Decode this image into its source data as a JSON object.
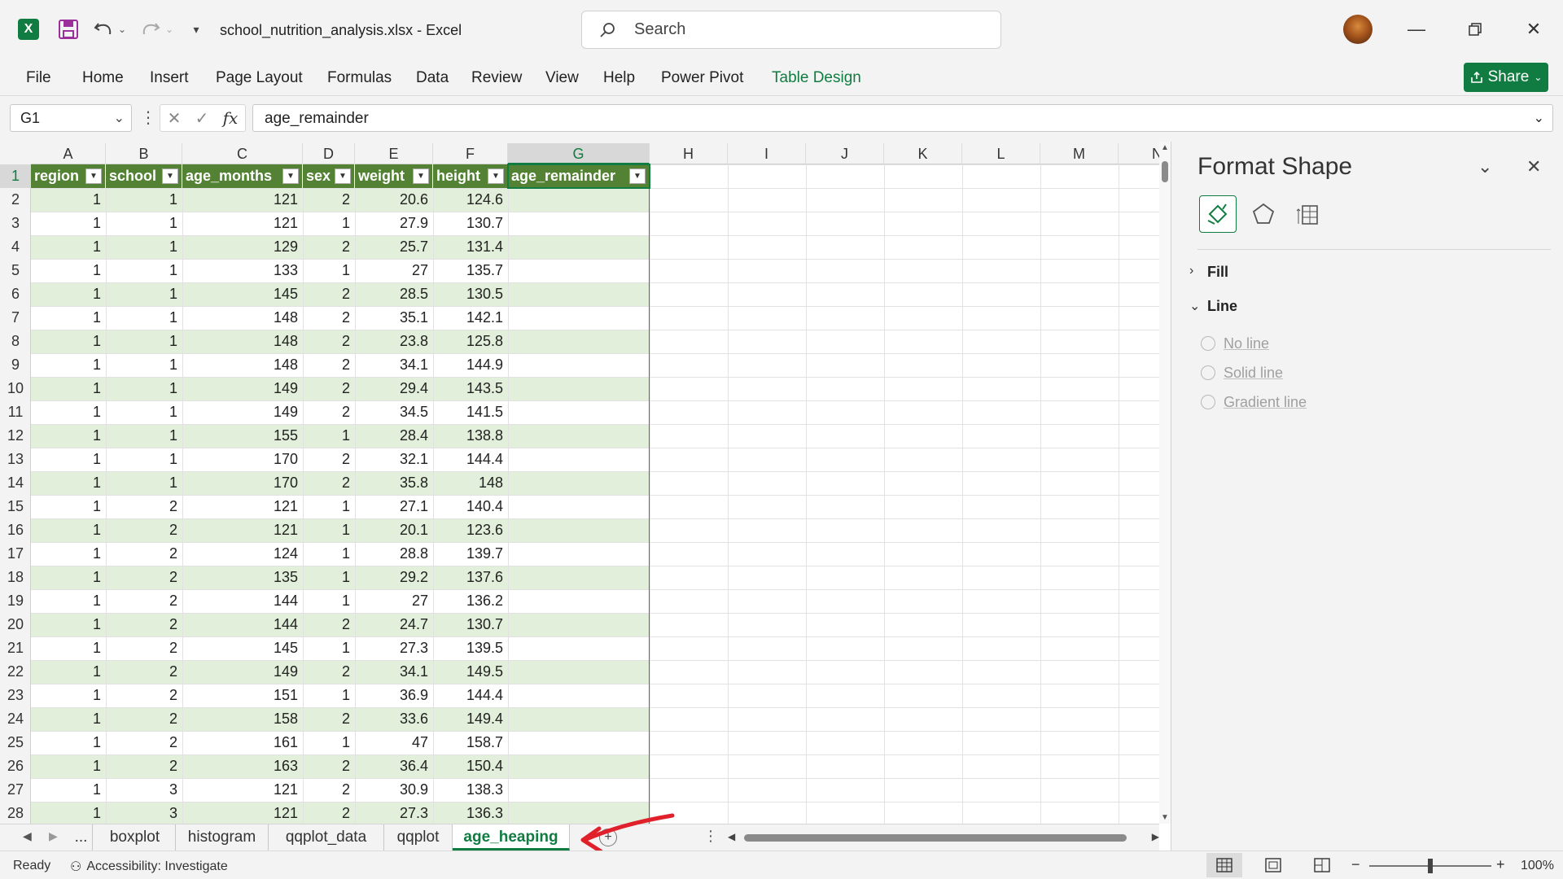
{
  "window": {
    "title": "school_nutrition_analysis.xlsx  -  Excel",
    "search_placeholder": "Search"
  },
  "ribbon": {
    "tabs": [
      "File",
      "Home",
      "Insert",
      "Page Layout",
      "Formulas",
      "Data",
      "Review",
      "View",
      "Help",
      "Power Pivot",
      "Table Design"
    ],
    "share_label": "Share"
  },
  "formula_bar": {
    "name_box": "G1",
    "formula": "age_remainder"
  },
  "sheet": {
    "column_letters": [
      "A",
      "B",
      "C",
      "D",
      "E",
      "F",
      "G",
      "H",
      "I",
      "J",
      "K",
      "L",
      "M",
      "N"
    ],
    "row_numbers": [
      "1",
      "2",
      "3",
      "4",
      "5",
      "6",
      "7",
      "8",
      "9",
      "10",
      "11",
      "12",
      "13",
      "14",
      "15",
      "16",
      "17",
      "18",
      "19",
      "20",
      "21",
      "22",
      "23",
      "24",
      "25",
      "26",
      "27",
      "28"
    ],
    "headers": [
      "region",
      "school",
      "age_months",
      "sex",
      "weight",
      "height",
      "age_remainder"
    ],
    "rows": [
      [
        "1",
        "1",
        "121",
        "2",
        "20.6",
        "124.6"
      ],
      [
        "1",
        "1",
        "121",
        "1",
        "27.9",
        "130.7"
      ],
      [
        "1",
        "1",
        "129",
        "2",
        "25.7",
        "131.4"
      ],
      [
        "1",
        "1",
        "133",
        "1",
        "27",
        "135.7"
      ],
      [
        "1",
        "1",
        "145",
        "2",
        "28.5",
        "130.5"
      ],
      [
        "1",
        "1",
        "148",
        "2",
        "35.1",
        "142.1"
      ],
      [
        "1",
        "1",
        "148",
        "2",
        "23.8",
        "125.8"
      ],
      [
        "1",
        "1",
        "148",
        "2",
        "34.1",
        "144.9"
      ],
      [
        "1",
        "1",
        "149",
        "2",
        "29.4",
        "143.5"
      ],
      [
        "1",
        "1",
        "149",
        "2",
        "34.5",
        "141.5"
      ],
      [
        "1",
        "1",
        "155",
        "1",
        "28.4",
        "138.8"
      ],
      [
        "1",
        "1",
        "170",
        "2",
        "32.1",
        "144.4"
      ],
      [
        "1",
        "1",
        "170",
        "2",
        "35.8",
        "148"
      ],
      [
        "1",
        "2",
        "121",
        "1",
        "27.1",
        "140.4"
      ],
      [
        "1",
        "2",
        "121",
        "1",
        "20.1",
        "123.6"
      ],
      [
        "1",
        "2",
        "124",
        "1",
        "28.8",
        "139.7"
      ],
      [
        "1",
        "2",
        "135",
        "1",
        "29.2",
        "137.6"
      ],
      [
        "1",
        "2",
        "144",
        "1",
        "27",
        "136.2"
      ],
      [
        "1",
        "2",
        "144",
        "2",
        "24.7",
        "130.7"
      ],
      [
        "1",
        "2",
        "145",
        "1",
        "27.3",
        "139.5"
      ],
      [
        "1",
        "2",
        "149",
        "2",
        "34.1",
        "149.5"
      ],
      [
        "1",
        "2",
        "151",
        "1",
        "36.9",
        "144.4"
      ],
      [
        "1",
        "2",
        "158",
        "2",
        "33.6",
        "149.4"
      ],
      [
        "1",
        "2",
        "161",
        "1",
        "47",
        "158.7"
      ],
      [
        "1",
        "2",
        "163",
        "2",
        "36.4",
        "150.4"
      ],
      [
        "1",
        "3",
        "121",
        "2",
        "30.9",
        "138.3"
      ],
      [
        "1",
        "3",
        "121",
        "2",
        "27.3",
        "136.3"
      ]
    ],
    "selected_cell": "G1"
  },
  "sheet_tabs": {
    "ellipsis": "...",
    "tabs": [
      "boxplot",
      "histogram",
      "qqplot_data",
      "qqplot",
      "age_heaping"
    ],
    "active": "age_heaping"
  },
  "status_bar": {
    "ready": "Ready",
    "accessibility": "Accessibility: Investigate",
    "zoom": "100%"
  },
  "format_pane": {
    "title": "Format Shape",
    "sections": {
      "fill": "Fill",
      "line": "Line"
    },
    "line_options": [
      "No line",
      "Solid line",
      "Gradient line"
    ]
  },
  "colors": {
    "excel_green": "#107c41",
    "table_header": "#548235",
    "band": "#e2efda",
    "annotation_arrow": "#e0202a"
  },
  "icons": [
    "excel-logo-icon",
    "save-icon",
    "undo-icon",
    "redo-icon",
    "customize-qat-icon",
    "search-icon",
    "minimize-icon",
    "restore-icon",
    "close-icon",
    "fill-line-icon",
    "effects-icon",
    "size-properties-icon"
  ]
}
